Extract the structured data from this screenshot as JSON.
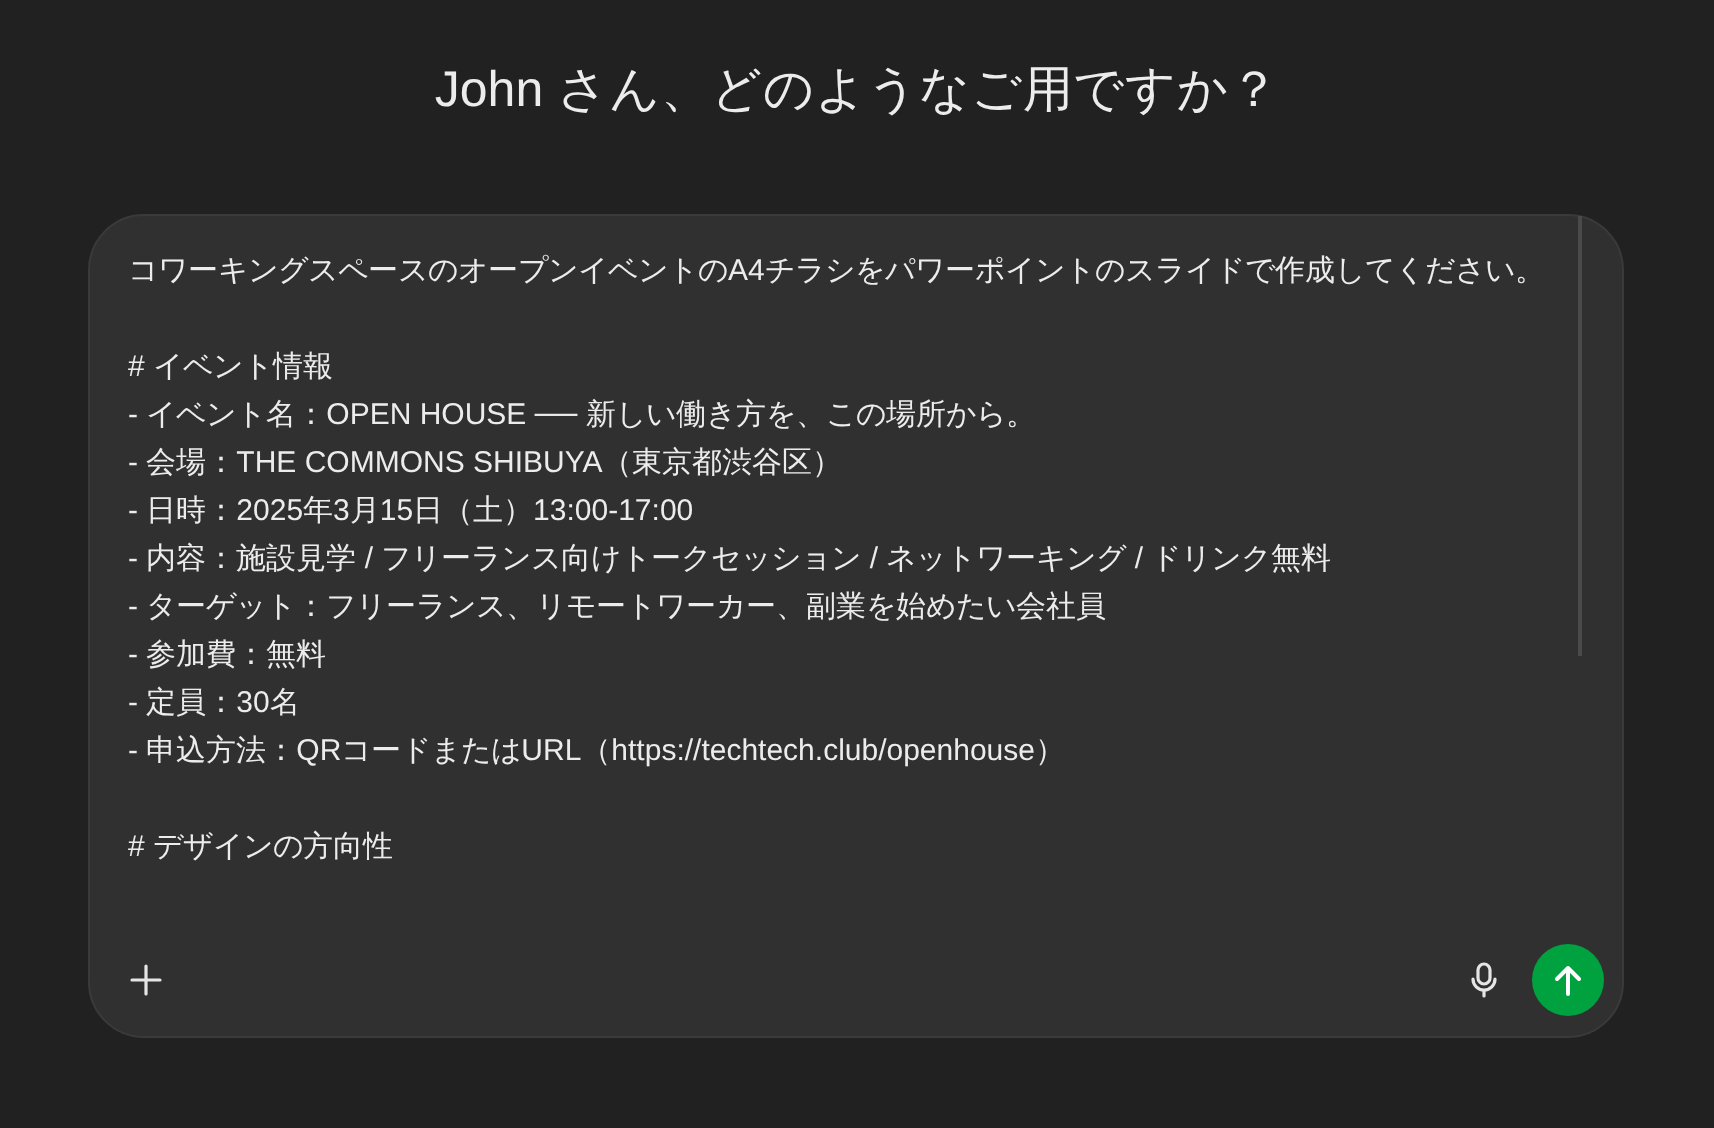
{
  "heading": "John さん、どのようなご用ですか？",
  "prompt": {
    "paragraphs": [
      [
        "コワーキングスペースのオープンイベントのA4チラシをパワーポイントのスライドで作成してください。"
      ],
      [
        "# イベント情報",
        "- イベント名：OPEN HOUSE ── 新しい働き方を、この場所から。",
        "- 会場：THE COMMONS SHIBUYA（東京都渋谷区）",
        "- 日時：2025年3月15日（土）13:00-17:00",
        "- 内容：施設見学 / フリーランス向けトークセッション / ネットワーキング / ドリンク無料",
        "- ターゲット：フリーランス、リモートワーカー、副業を始めたい会社員",
        "- 参加費：無料",
        "- 定員：30名",
        "- 申込方法：QRコードまたはURL（https://techtech.club/openhouse）"
      ],
      [
        "# デザインの方向性"
      ]
    ]
  }
}
